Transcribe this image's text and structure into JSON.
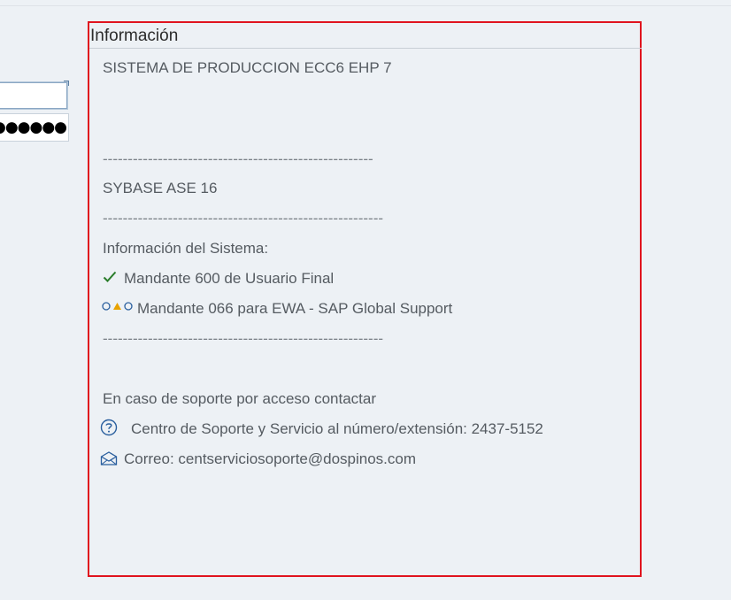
{
  "login": {
    "user_value": "",
    "password_mask": "●●●●●●●●●●●"
  },
  "panel": {
    "title": "Información",
    "system_name": "SISTEMA DE PRODUCCION ECC6 EHP 7",
    "separator": "------------------------------------------------------",
    "database": "SYBASE ASE 16",
    "separator_2": "--------------------------------------------------------",
    "system_info_label": "Información del Sistema:",
    "client_1": "Mandante 600 de Usuario Final",
    "client_2": "Mandante 066 para EWA - SAP Global Support",
    "separator_3": "--------------------------------------------------------",
    "support_intro": "En caso de soporte por acceso contactar",
    "support_center": "Centro de Soporte y Servicio al número/extensión: 2437-5152",
    "email": "Correo: centserviciosoporte@dospinos.com"
  },
  "colors": {
    "background": "#edf1f5",
    "panel_border": "#e0141e",
    "check": "#2b7d2b",
    "triangle": "#e8a200",
    "circle": "#2a5f9e",
    "text": "#555b61"
  },
  "icons": {
    "check": "check-icon",
    "status": "status-indicator-icon",
    "help": "help-icon",
    "mail": "envelope-icon"
  }
}
